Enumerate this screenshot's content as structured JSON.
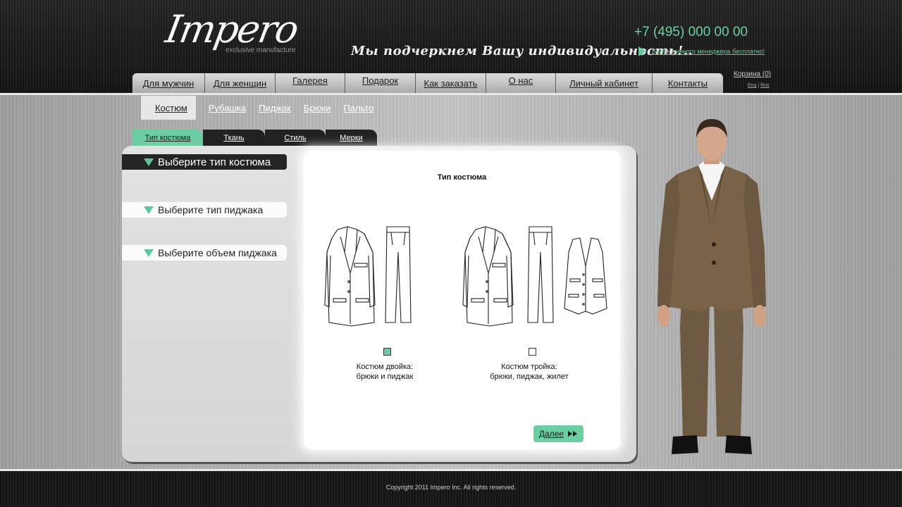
{
  "brand": {
    "logo": "Impero",
    "tagline": "exclusive manufacture"
  },
  "header": {
    "slogan": "Мы подчеркнем Вашу индивидуальность!..",
    "phone": "+7 (495) 000 00 00",
    "manager_link": "Вызов личного менеджера бесплатно!",
    "cart": "Корзина (0)",
    "lang_en": "Eng",
    "lang_sep": "|",
    "lang_ru": "Rus"
  },
  "nav": {
    "items": [
      {
        "label": "Для мужчин"
      },
      {
        "label": "Для женщин"
      },
      {
        "label": "Галерея"
      },
      {
        "label": "Подарок"
      },
      {
        "label": "Как заказать"
      },
      {
        "label": "О нас"
      },
      {
        "label": "Личный кабинет"
      },
      {
        "label": "Контакты"
      }
    ]
  },
  "subnav": {
    "items": [
      {
        "label": "Костюм",
        "active": true
      },
      {
        "label": "Рубашка"
      },
      {
        "label": "Пиджак"
      },
      {
        "label": "Брюки"
      },
      {
        "label": "Пальто"
      }
    ]
  },
  "tabs": [
    {
      "label": "Тип костюма",
      "active": true
    },
    {
      "label": "Ткань"
    },
    {
      "label": "Стиль"
    },
    {
      "label": "Мерки"
    }
  ],
  "sections": {
    "suit_type": "Выберите тип костюма",
    "jacket_type": "Выберите тип пиджака",
    "jacket_volume": "Выберите объем пиджака"
  },
  "content": {
    "title": "Тип костюма",
    "options": [
      {
        "caption": "Костюм двойка:\nбрюки и пиджак",
        "selected": true
      },
      {
        "caption": "Костюм тройка:\nбрюки, пиджак, жилет",
        "selected": false
      }
    ],
    "next_label": "Далее"
  },
  "footer": {
    "copyright": "Copyright 2011 Impero Inc. All rights reserved."
  },
  "colors": {
    "accent": "#6ccda2",
    "phone": "#6ed2a6",
    "header_bg": "#1a1a1a"
  }
}
